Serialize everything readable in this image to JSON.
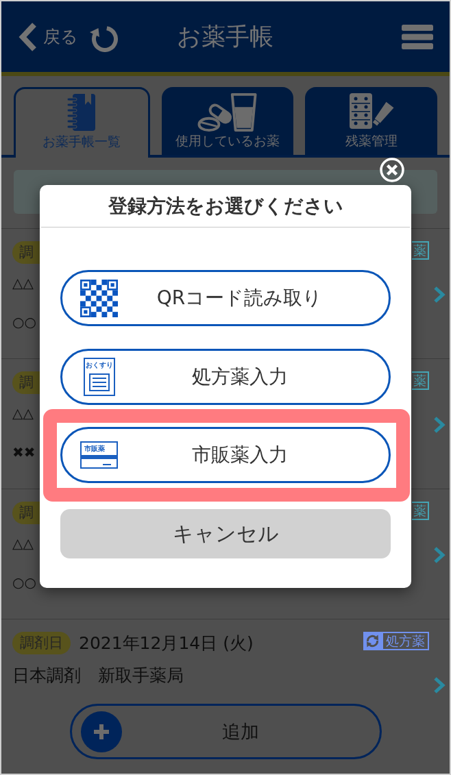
{
  "header": {
    "back_label": "戻る",
    "title": "お薬手帳"
  },
  "tabs": [
    {
      "label": "お薬手帳一覧",
      "selected": true
    },
    {
      "label": "使用しているお薬",
      "selected": false
    },
    {
      "label": "残薬管理",
      "selected": false
    }
  ],
  "records": [
    {
      "kind": "partial",
      "badge": "調",
      "lines": [
        "△△",
        "○○"
      ],
      "tag": {
        "kind": "plain",
        "label": "薬",
        "color": "#46a6b6"
      }
    },
    {
      "kind": "partial",
      "badge": "調",
      "lines": [
        "△△",
        "✖✖"
      ],
      "tag": {
        "kind": "plain",
        "label": "薬",
        "color": "#46a6b6"
      }
    },
    {
      "kind": "partial",
      "badge": "調",
      "lines": [
        "△△",
        "○○"
      ],
      "tag": {
        "kind": "plain",
        "label": "薬",
        "color": "#46a6b6"
      }
    },
    {
      "kind": "full",
      "badge": "調剤日",
      "date": "2021年12月14日 (火)",
      "lines": [
        "日本調剤　新取手薬局"
      ],
      "tag": {
        "kind": "sync",
        "label": "処方薬",
        "color": "#7191ee"
      }
    }
  ],
  "add_button": {
    "label": "追加"
  },
  "dialog": {
    "title": "登録方法をお選びください",
    "options": [
      {
        "kind": "qr",
        "label": "QRコード読み取り",
        "highlighted": false
      },
      {
        "kind": "prescription",
        "icon_text": "おくすり",
        "label": "処方薬入力",
        "highlighted": false
      },
      {
        "kind": "otc",
        "icon_text": "市販薬",
        "label": "市販薬入力",
        "highlighted": true
      }
    ],
    "cancel_label": "キャンセル"
  }
}
